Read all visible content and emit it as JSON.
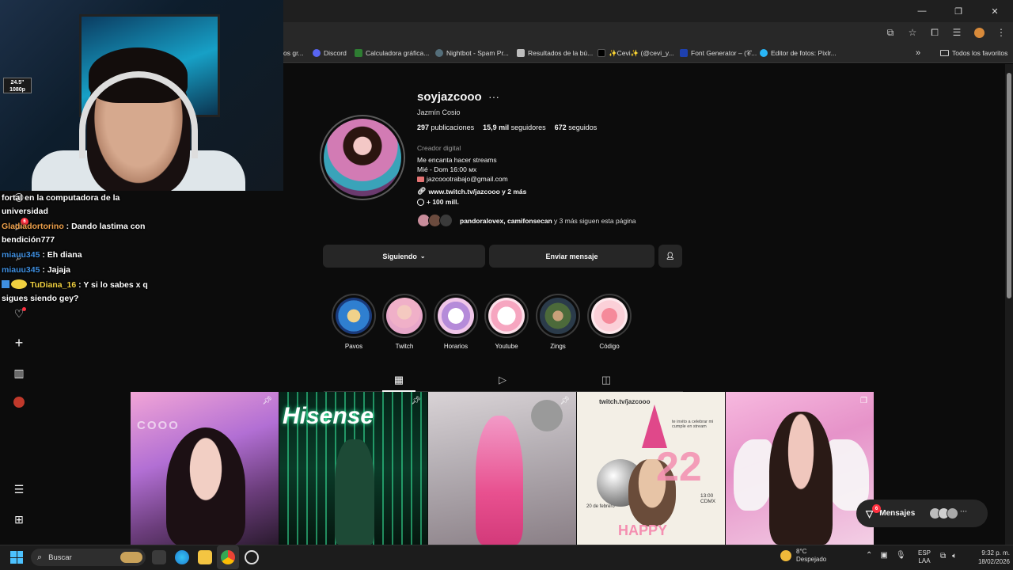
{
  "window": {
    "minimize": "—",
    "maximize": "❐",
    "close": "✕"
  },
  "bookmarks": [
    {
      "label": "os gr...",
      "color": "#5a5a5a"
    },
    {
      "label": "Discord",
      "color": "#5865f2"
    },
    {
      "label": "Calculadora gráfica...",
      "color": "#2e7d32"
    },
    {
      "label": "Nightbot - Spam Pr...",
      "color": "#546e7a"
    },
    {
      "label": "Resultados de la bú...",
      "color": "#9e9e9e"
    },
    {
      "label": "✨Cevi✨ (@cevi_y...",
      "color": "#111111"
    },
    {
      "label": "Font Generator – (𝒞...",
      "color": "#1e40af"
    },
    {
      "label": "Editor de fotos: Pixlr...",
      "color": "#29b6f6"
    }
  ],
  "bookmarks_more": "»",
  "all_favorites": "Todos los favoritos",
  "profile": {
    "username": "soyjazcooo",
    "more": "···",
    "full_name": "Jazmín Cosio",
    "posts_count": "297",
    "posts_label": "publicaciones",
    "followers_count": "15,9 mil",
    "followers_label": "seguidores",
    "following_count": "672",
    "following_label": "seguidos",
    "category": "Creador digital",
    "bio_line1": "Me encanta hacer streams",
    "bio_line2": "Mié - Dom 16:00 ᴍx",
    "bio_email": "jazcoootrabajo@gmail.com",
    "bio_link": "www.twitch.tv/jazcooo y 2 más",
    "bio_threads": "+ 100 mill.",
    "followed_by_names": "pandoralovex, camifonsecan",
    "followed_by_rest": " y 3 más siguen esta página"
  },
  "buttons": {
    "following": "Siguiendo",
    "message": "Enviar mensaje"
  },
  "highlights": [
    {
      "label": "Pavos"
    },
    {
      "label": "Twitch"
    },
    {
      "label": "Horarios"
    },
    {
      "label": "Youtube"
    },
    {
      "label": "Zings"
    },
    {
      "label": "Código"
    }
  ],
  "posts": [
    {
      "overlay": "COOO"
    },
    {
      "overlay": "Hisense"
    },
    {
      "overlay": ""
    },
    {
      "overlay": "twitch.tv/jazcooo",
      "sub1": "te invito a celebrar mi cumple en stream",
      "sub2": "20 de febrero",
      "sub3": "13:00 CDMX",
      "sub4": "HAPPY"
    },
    {
      "overlay": ""
    }
  ],
  "chat": [
    {
      "user": "",
      "text": "fortal en la computadora de la"
    },
    {
      "user": "",
      "text": "universidad"
    },
    {
      "user": "Gladiadortorino",
      "text": " : Dando lastima con"
    },
    {
      "user": "",
      "text": "bendición777"
    },
    {
      "user": "miauu345",
      "text": " : Eh diana"
    },
    {
      "user": "miauu345",
      "text": " : Jajaja"
    },
    {
      "user": "TuDiana_16",
      "text": " : Y si lo sabes x q"
    },
    {
      "user": "",
      "text": "sigues siendo gey?"
    }
  ],
  "webcam_sticker": "24.5\" 1080p",
  "messages": {
    "label": "Mensajes",
    "badge": "6"
  },
  "nav_badge": "6",
  "taskbar": {
    "search": "Buscar",
    "temp": "8°C",
    "condition": "Despejado",
    "lang_top": "ESP",
    "lang_bottom": "LAA",
    "time": "9:32 p. m.",
    "date": "18/02/2026"
  }
}
